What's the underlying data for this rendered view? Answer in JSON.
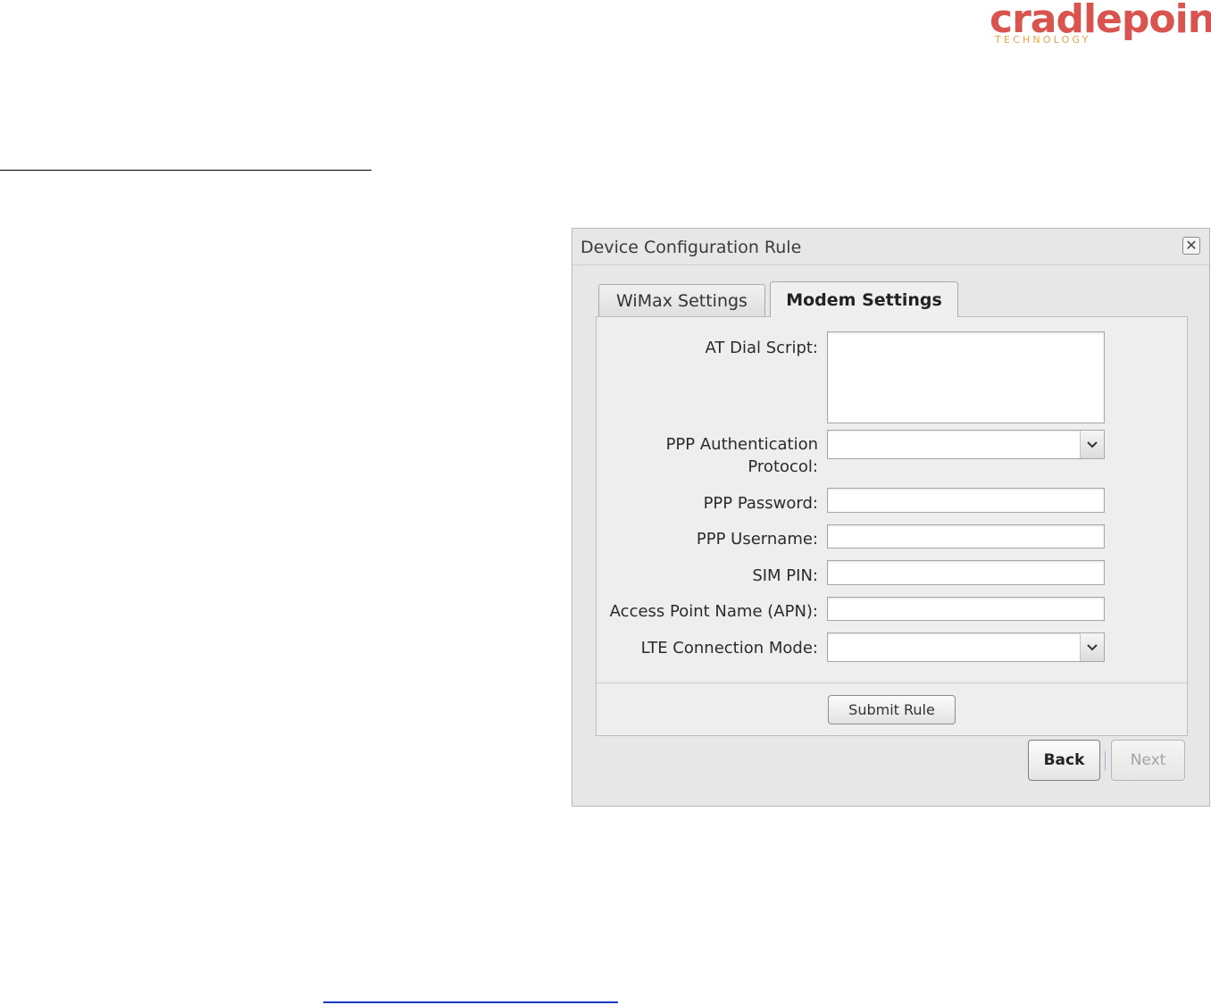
{
  "brand": {
    "logo_name": "cradlepoint",
    "logo_tagline": "TECHNOLOGY",
    "primary_color": "#d9534f",
    "tagline_color": "#e3a24a"
  },
  "dialog": {
    "title": "Device Configuration Rule",
    "close_icon": "close-icon",
    "tabs": [
      {
        "label": "WiMax Settings",
        "active": false
      },
      {
        "label": "Modem Settings",
        "active": true
      }
    ],
    "fields": {
      "at_dial_script": {
        "label": "AT Dial Script:",
        "value": ""
      },
      "ppp_auth_protocol": {
        "label_line1": "PPP Authentication",
        "label_line2": "Protocol:",
        "value": ""
      },
      "ppp_password": {
        "label": "PPP Password:",
        "value": ""
      },
      "ppp_username": {
        "label": "PPP Username:",
        "value": ""
      },
      "sim_pin": {
        "label": "SIM PIN:",
        "value": ""
      },
      "apn": {
        "label": "Access Point Name (APN):",
        "value": ""
      },
      "lte_connection_mode": {
        "label": "LTE Connection Mode:",
        "value": ""
      }
    },
    "submit_label": "Submit Rule",
    "back_label": "Back",
    "next_label": "Next"
  }
}
